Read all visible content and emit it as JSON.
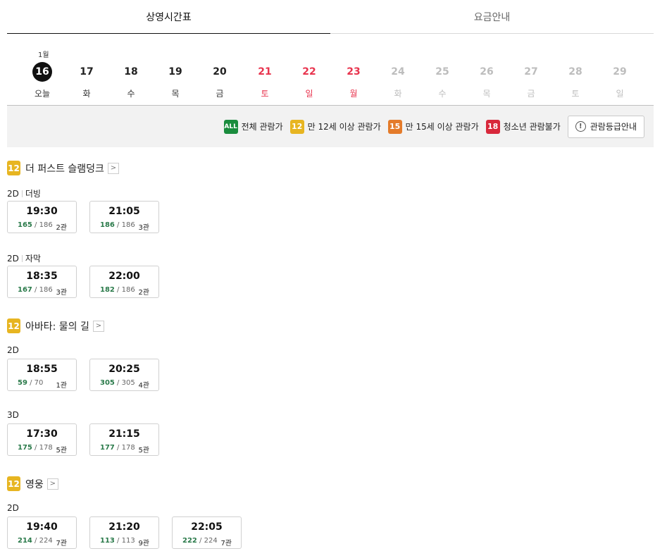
{
  "tabs": [
    {
      "label": "상영시간표",
      "active": true
    },
    {
      "label": "요금안내",
      "active": false
    }
  ],
  "month_label": "1월",
  "dates": [
    {
      "num": "16",
      "wd": "오늘",
      "state": "today"
    },
    {
      "num": "17",
      "wd": "화",
      "state": "normal"
    },
    {
      "num": "18",
      "wd": "수",
      "state": "normal"
    },
    {
      "num": "19",
      "wd": "목",
      "state": "normal"
    },
    {
      "num": "20",
      "wd": "금",
      "state": "normal"
    },
    {
      "num": "21",
      "wd": "토",
      "state": "weekend"
    },
    {
      "num": "22",
      "wd": "일",
      "state": "weekend"
    },
    {
      "num": "23",
      "wd": "월",
      "state": "weekend"
    },
    {
      "num": "24",
      "wd": "화",
      "state": "disabled"
    },
    {
      "num": "25",
      "wd": "수",
      "state": "disabled"
    },
    {
      "num": "26",
      "wd": "목",
      "state": "disabled"
    },
    {
      "num": "27",
      "wd": "금",
      "state": "disabled"
    },
    {
      "num": "28",
      "wd": "토",
      "state": "disabled"
    },
    {
      "num": "29",
      "wd": "일",
      "state": "disabled"
    }
  ],
  "ratings": [
    {
      "badge": "ALL",
      "label": "전체 관람가",
      "color": "#1a8c3d"
    },
    {
      "badge": "12",
      "label": "만 12세 이상 관람가",
      "color": "#e7b521"
    },
    {
      "badge": "15",
      "label": "만 15세 이상 관람가",
      "color": "#e47b2a"
    },
    {
      "badge": "18",
      "label": "청소년 관람불가",
      "color": "#d8283b"
    }
  ],
  "rating_guide_label": "관람등급안내",
  "movies": [
    {
      "rating": "12",
      "title": "더 퍼스트 슬램덩크",
      "formats": [
        {
          "type": "2D",
          "sub": "더빙",
          "slots": [
            {
              "time": "19:30",
              "avail": "165",
              "total": "186",
              "hall": "2관"
            },
            {
              "time": "21:05",
              "avail": "186",
              "total": "186",
              "hall": "3관"
            }
          ]
        },
        {
          "type": "2D",
          "sub": "자막",
          "slots": [
            {
              "time": "18:35",
              "avail": "167",
              "total": "186",
              "hall": "3관"
            },
            {
              "time": "22:00",
              "avail": "182",
              "total": "186",
              "hall": "2관"
            }
          ]
        }
      ]
    },
    {
      "rating": "12",
      "title": "아바타: 물의 길",
      "formats": [
        {
          "type": "2D",
          "sub": "",
          "slots": [
            {
              "time": "18:55",
              "avail": "59",
              "total": "70",
              "hall": "1관"
            },
            {
              "time": "20:25",
              "avail": "305",
              "total": "305",
              "hall": "4관"
            }
          ]
        },
        {
          "type": "3D",
          "sub": "",
          "slots": [
            {
              "time": "17:30",
              "avail": "175",
              "total": "178",
              "hall": "5관"
            },
            {
              "time": "21:15",
              "avail": "177",
              "total": "178",
              "hall": "5관"
            }
          ]
        }
      ]
    },
    {
      "rating": "12",
      "title": "영웅",
      "formats": [
        {
          "type": "2D",
          "sub": "",
          "slots": [
            {
              "time": "19:40",
              "avail": "214",
              "total": "224",
              "hall": "7관"
            },
            {
              "time": "21:20",
              "avail": "113",
              "total": "113",
              "hall": "9관"
            },
            {
              "time": "22:05",
              "avail": "222",
              "total": "224",
              "hall": "7관"
            }
          ]
        }
      ]
    }
  ]
}
